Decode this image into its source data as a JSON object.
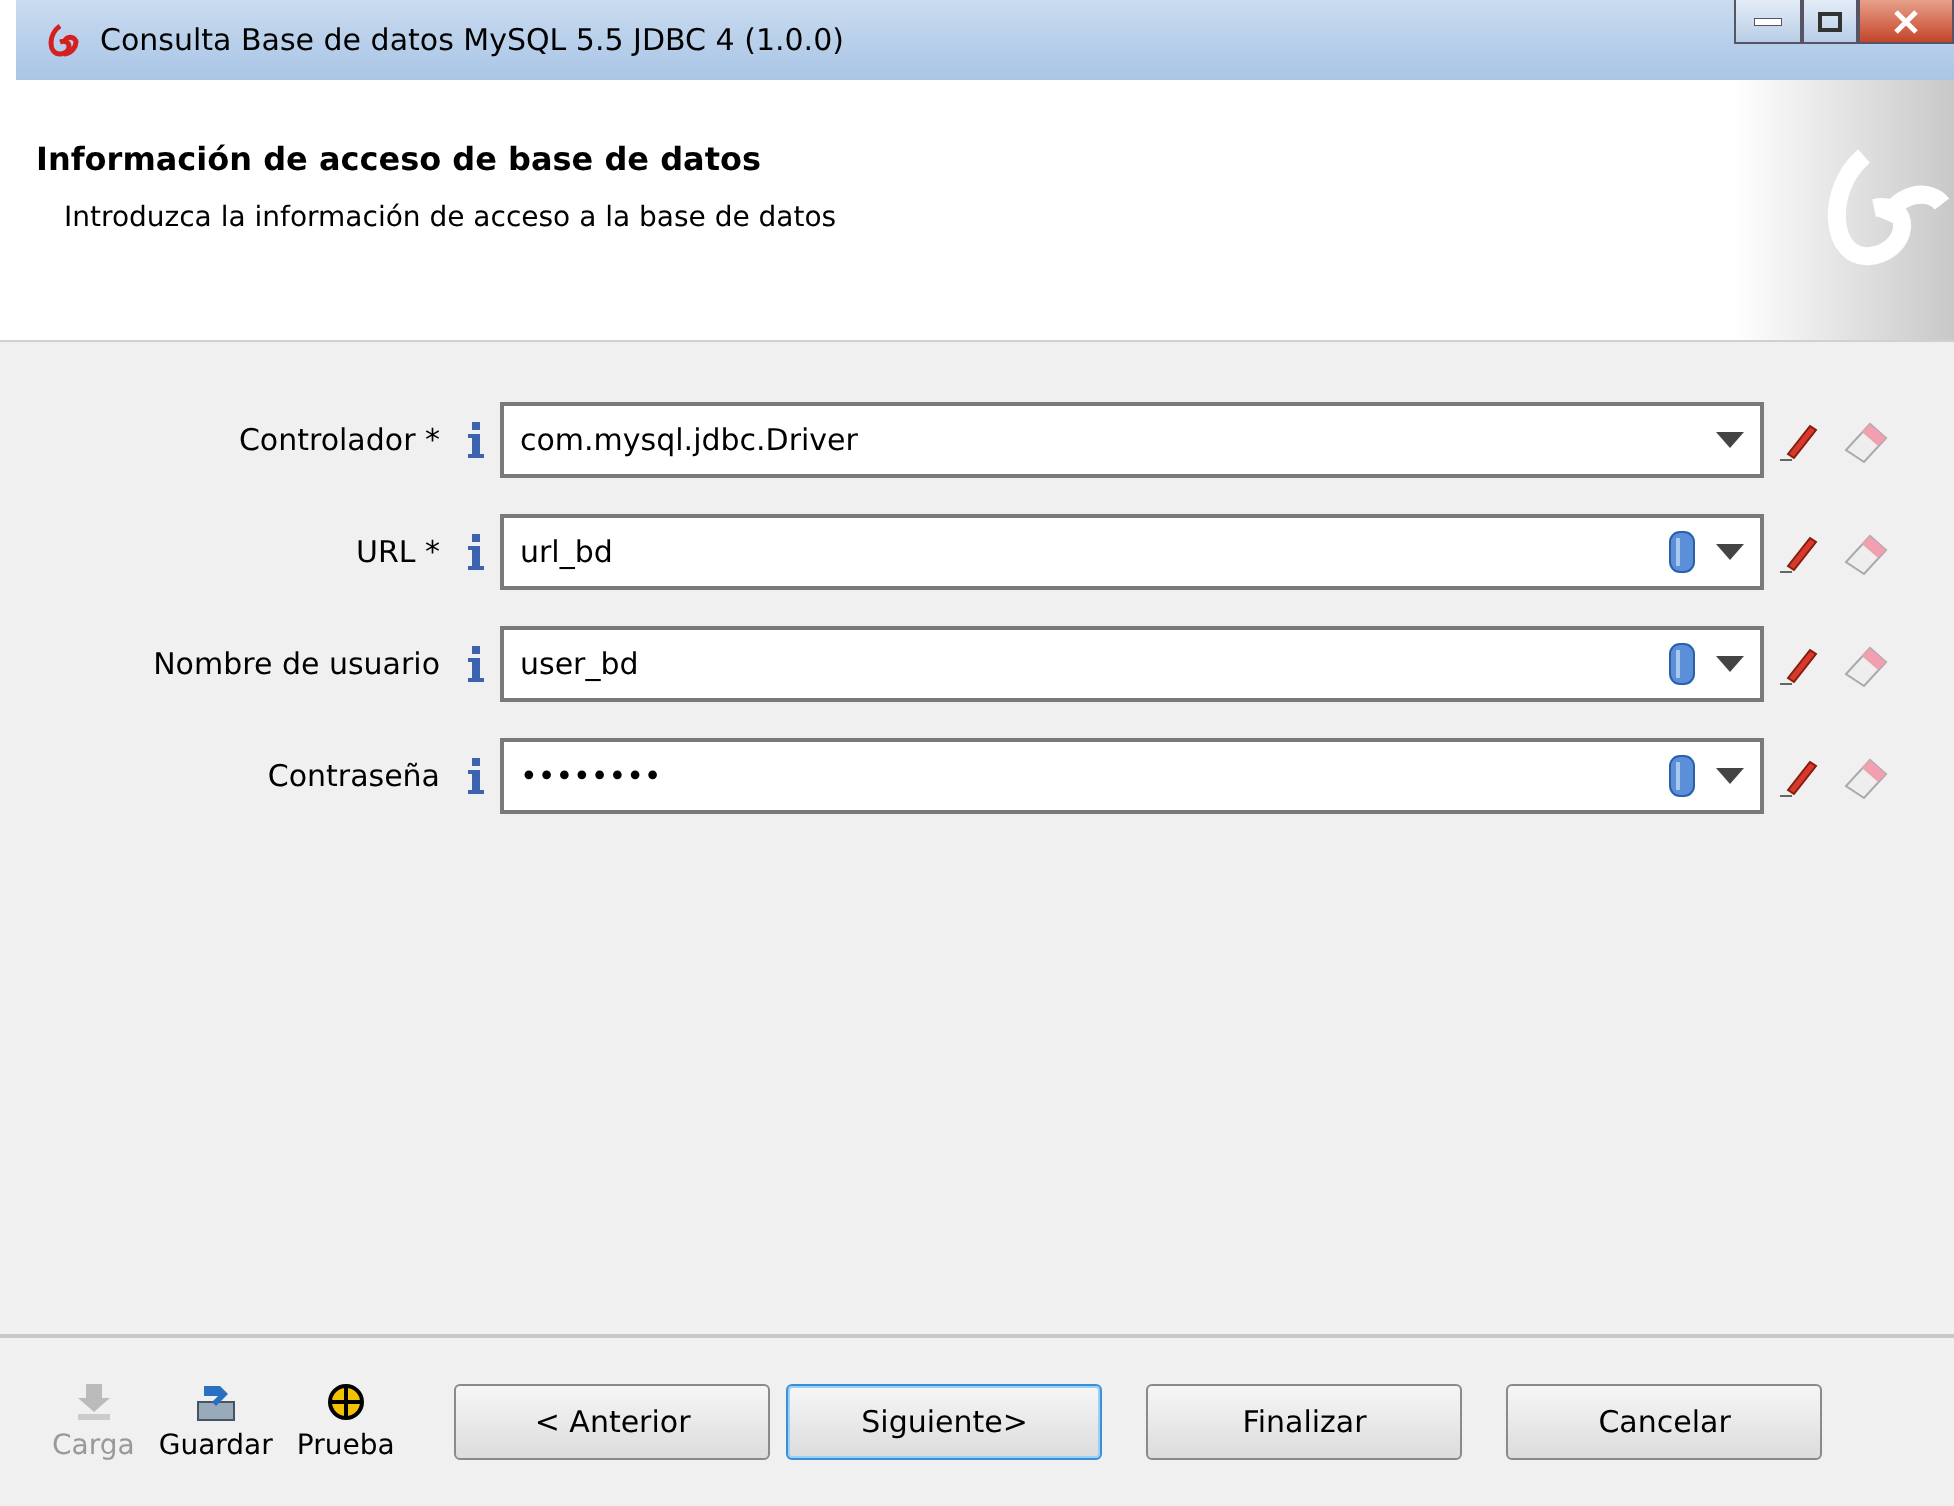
{
  "window": {
    "title": "Consulta Base de datos MySQL 5.5 JDBC 4 (1.0.0)"
  },
  "header": {
    "title": "Información de acceso de base de datos",
    "subtitle": "Introduzca la información de acceso a la base de datos"
  },
  "fields": [
    {
      "label": "Controlador *",
      "value": "com.mysql.jdbc.Driver",
      "kind": "combo"
    },
    {
      "label": "URL *",
      "value": "url_bd",
      "kind": "variable"
    },
    {
      "label": "Nombre de usuario",
      "value": "user_bd",
      "kind": "variable"
    },
    {
      "label": "Contraseña",
      "value": "••••••••",
      "kind": "variable"
    }
  ],
  "tools": [
    {
      "label": "Carga",
      "kind": "load",
      "disabled": true
    },
    {
      "label": "Guardar",
      "kind": "save",
      "disabled": false
    },
    {
      "label": "Prueba",
      "kind": "test",
      "disabled": false
    }
  ],
  "buttons": [
    {
      "label": "< Anterior",
      "selected": false
    },
    {
      "label": "Siguiente>",
      "selected": true
    },
    {
      "label": "Finalizar",
      "selected": false
    },
    {
      "label": "Cancelar",
      "selected": false
    }
  ]
}
